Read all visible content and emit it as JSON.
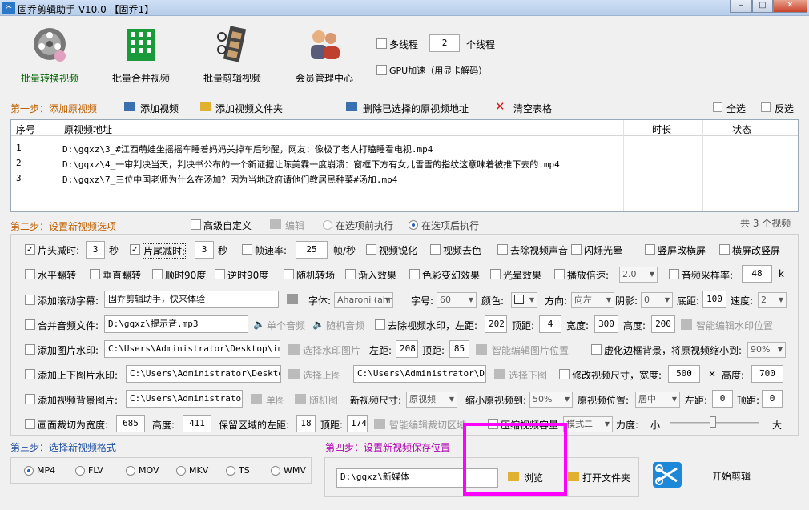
{
  "window": {
    "title": "固乔剪辑助手 V10.0 【固乔1】",
    "min": "–",
    "max": "□",
    "close": "✕"
  },
  "toolbar": {
    "batch_convert": "批量转换视频",
    "batch_merge": "批量合并视频",
    "batch_edit": "批量剪辑视频",
    "member": "会员管理中心",
    "multithread_label": "多线程",
    "thread_count": "2",
    "thread_unit": "个线程",
    "gpu_label": "GPU加速（用显卡解码）"
  },
  "step1": {
    "title": "第一步：添加原视频",
    "add_video": "添加视频",
    "add_folder": "添加视频文件夹",
    "delete_selected": "删除已选择的原视频地址",
    "clear_table": "清空表格",
    "select_all": "全选",
    "invert": "反选",
    "columns": {
      "index": "序号",
      "path": "原视频地址",
      "duration": "时长",
      "status": "状态"
    },
    "rows": [
      {
        "index": "1",
        "path": "D:\\gqxz\\3_#江西萌娃坐摇摇车睡着妈妈关掉车后秒醒，网友：像极了老人打瞌睡看电视.mp4"
      },
      {
        "index": "2",
        "path": "D:\\gqxz\\4_一审判决当天，判决书公布的一个新证据让陈美霖一度崩溃：窗框下方有女儿雪雪的指纹这意味着被推下去的.mp4"
      },
      {
        "index": "3",
        "path": "D:\\gqxz\\7_三位中国老师为什么在汤加？因为当地政府请他们教居民种菜#汤加.mp4"
      }
    ],
    "count_text": "共 3 个视频"
  },
  "step2": {
    "title": "第二步：设置新视频选项",
    "advanced": "高级自定义",
    "edit": "编辑",
    "before_opt": "在选项前执行",
    "after_opt": "在选项后执行",
    "r1": {
      "head_cut": "片头减时:",
      "head_val": "3",
      "sec1": "秒",
      "tail_cut": "片尾减时:",
      "tail_val": "3",
      "sec2": "秒",
      "fps": "帧速率:",
      "fps_val": "25",
      "fps_unit": "帧/秒",
      "sharpen": "视频锐化",
      "decolor": "视频去色",
      "remove_audio": "去除视频声音",
      "flash": "闪烁光晕",
      "v2h": "竖屏改横屏",
      "h2v": "横屏改竖屏"
    },
    "r2": {
      "hflip": "水平翻转",
      "vflip": "垂直翻转",
      "cw90": "顺时90度",
      "ccw90": "逆时90度",
      "rand_trans": "随机转场",
      "fade_in": "渐入效果",
      "color_fx": "色彩变幻效果",
      "halo": "光晕效果",
      "speed": "播放倍速:",
      "speed_val": "2.0",
      "sample": "音频采样率:",
      "sample_val": "48",
      "k": "k"
    },
    "r3": {
      "scroll": "添加滚动字幕:",
      "scroll_text": "固乔剪辑助手，快来体验",
      "font": "字体:",
      "font_val": "Aharoni (ahr",
      "size": "字号:",
      "size_val": "60",
      "color": "颜色:",
      "dir": "方向:",
      "dir_val": "向左",
      "shadow": "阴影:",
      "shadow_val": "0",
      "bottom": "底距:",
      "bottom_val": "100",
      "speed": "速度:",
      "speed_val": "2"
    },
    "r4": {
      "merge_audio": "合并音频文件:",
      "audio_path": "D:\\gqxz\\提示音.mp3",
      "single": "单个音频",
      "random": "随机音频",
      "remove_wm": "去除视频水印，左距:",
      "left": "202",
      "top_lbl": "顶距:",
      "top": "4",
      "width_lbl": "宽度:",
      "width": "300",
      "height_lbl": "高度:",
      "height": "200",
      "smart_wm": "智能编辑水印位置"
    },
    "r5": {
      "img_wm": "添加图片水印:",
      "img_path": "C:\\Users\\Administrator\\Desktop\\img-q",
      "choose": "选择水印图片",
      "left_lbl": "左距:",
      "left": "208",
      "top_lbl": "顶距:",
      "top": "85",
      "smart": "智能编辑图片位置",
      "blur_bg": "虚化边框背景，将原视频缩小到:",
      "blur_val": "90%"
    },
    "r6": {
      "updown": "添加上下图片水印:",
      "up_path": "C:\\Users\\Administrator\\Desktop\\i",
      "choose_up": "选择上图",
      "down_path": "C:\\Users\\Administrator\\Desk",
      "choose_down": "选择下图",
      "resize": "修改视频尺寸，宽度:",
      "w": "500",
      "x": "×",
      "h_lbl": "高度:",
      "h": "700"
    },
    "r7": {
      "bg": "添加视频背景图片:",
      "bg_path": "C:\\Users\\Administrator\\D",
      "single": "单图",
      "random": "随机图",
      "new_size": "新视频尺寸:",
      "new_size_val": "原视频",
      "shrink": "缩小原视频到:",
      "shrink_val": "50%",
      "pos": "原视频位置:",
      "pos_val": "居中",
      "left_lbl": "左距:",
      "left": "0",
      "top_lbl": "顶距:",
      "top": "0"
    },
    "r8": {
      "crop": "画面裁切为宽度:",
      "w": "685",
      "h_lbl": "高度:",
      "h": "411",
      "keep_left": "保留区域的左距:",
      "left": "18",
      "top_lbl": "顶距:",
      "top": "174",
      "smart_crop": "智能编辑裁切区域",
      "compress": "压缩视频容量",
      "mode_val": "模式二",
      "strength": "力度:",
      "small": "小",
      "large": "大"
    }
  },
  "step3": {
    "title": "第三步：选择新视频格式",
    "formats": [
      "MP4",
      "FLV",
      "MOV",
      "MKV",
      "TS",
      "WMV"
    ]
  },
  "step4": {
    "title": "第四步：设置新视频保存位置",
    "path": "D:\\gqxz\\新媒体",
    "browse": "浏览",
    "open_folder": "打开文件夹",
    "start": "开始剪辑"
  },
  "colors": {
    "accent_orange": "#c06000",
    "highlight_magenta": "#ff00ff",
    "step4_text": "#b000b0"
  }
}
